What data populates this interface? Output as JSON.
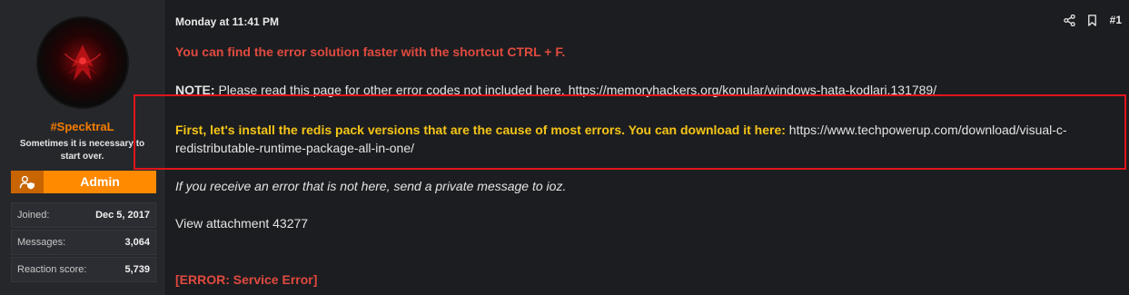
{
  "user": {
    "username": "#SpecktraL",
    "user_title": "Sometimes it is necessary to start over.",
    "banner_label": "Admin",
    "stats": [
      {
        "label": "Joined:",
        "value": "Dec 5, 2017"
      },
      {
        "label": "Messages:",
        "value": "3,064"
      },
      {
        "label": "Reaction score:",
        "value": "5,739"
      }
    ]
  },
  "post": {
    "date": "Monday at 11:41 PM",
    "number": "#1",
    "line1": "You can find the error solution faster with the shortcut CTRL + F.",
    "note_label": "NOTE:",
    "note_text": " Please read this page for other error codes not included here. ",
    "note_link": "https://memoryhackers.org/konular/windows-hata-kodlari.131789/",
    "highlight_strong": "First, let's install the redis pack versions that are the cause of most errors. You can download it here:",
    "highlight_link": "https://www.techpowerup.com/download/visual-c-redistributable-runtime-package-all-in-one/",
    "italic_line": "If you receive an error that is not here, send a private message to ioz.",
    "attachment": "View attachment 43277",
    "error": "[ERROR: Service Error]"
  },
  "colors": {
    "accent_orange": "#ff8a00",
    "error_red": "#e04a3f",
    "highlight_yellow": "#f5c518",
    "box_red": "#e1141b"
  },
  "icons": {
    "share": "share-icon",
    "bookmark": "bookmark-icon",
    "banner": "user-shield-icon"
  }
}
